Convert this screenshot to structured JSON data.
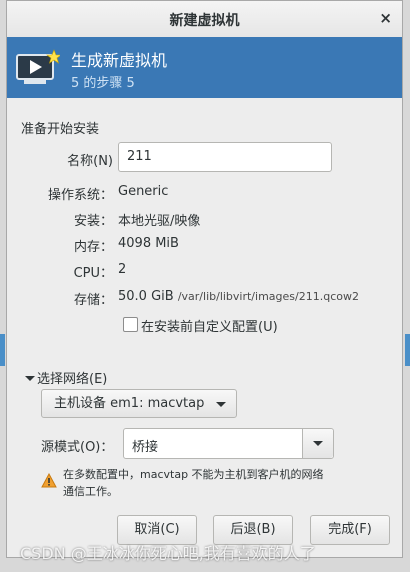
{
  "window": {
    "title": "新建虚拟机",
    "close_glyph": "×"
  },
  "banner": {
    "title": "生成新虚拟机",
    "step": "5 的步骤 5",
    "icon": "monitor-play-icon"
  },
  "section_title": "准备开始安装",
  "name_field": {
    "label": "名称(N)",
    "value": "211"
  },
  "details": [
    {
      "label": "操作系统：",
      "value": "Generic"
    },
    {
      "label": "安装：",
      "value": "本地光驱/映像"
    },
    {
      "label": "内存：",
      "value": "4098 MiB"
    },
    {
      "label": "CPU：",
      "value": "2"
    },
    {
      "label": "存储：",
      "value": "50.0 GiB",
      "path": "/var/lib/libvirt/images/211.qcow2"
    }
  ],
  "customize_checkbox": {
    "label": "在安装前自定义配置(U)",
    "checked": false
  },
  "network": {
    "expander_label": "选择网络(E)",
    "device_button": "主机设备 em1: macvtap",
    "source_mode_label": "源模式(O)：",
    "source_mode_value": "桥接",
    "warning_line1": "在多数配置中，macvtap 不能为主机到客户机的网络",
    "warning_line2": "通信工作。"
  },
  "buttons": {
    "cancel": "取消(C)",
    "back": "后退(B)",
    "finish": "完成(F)"
  },
  "watermark": "CSDN @王冰冰你死心吧,我有喜欢的人了",
  "colors": {
    "banner": "#3a78b5",
    "warning": "#f0a030"
  }
}
